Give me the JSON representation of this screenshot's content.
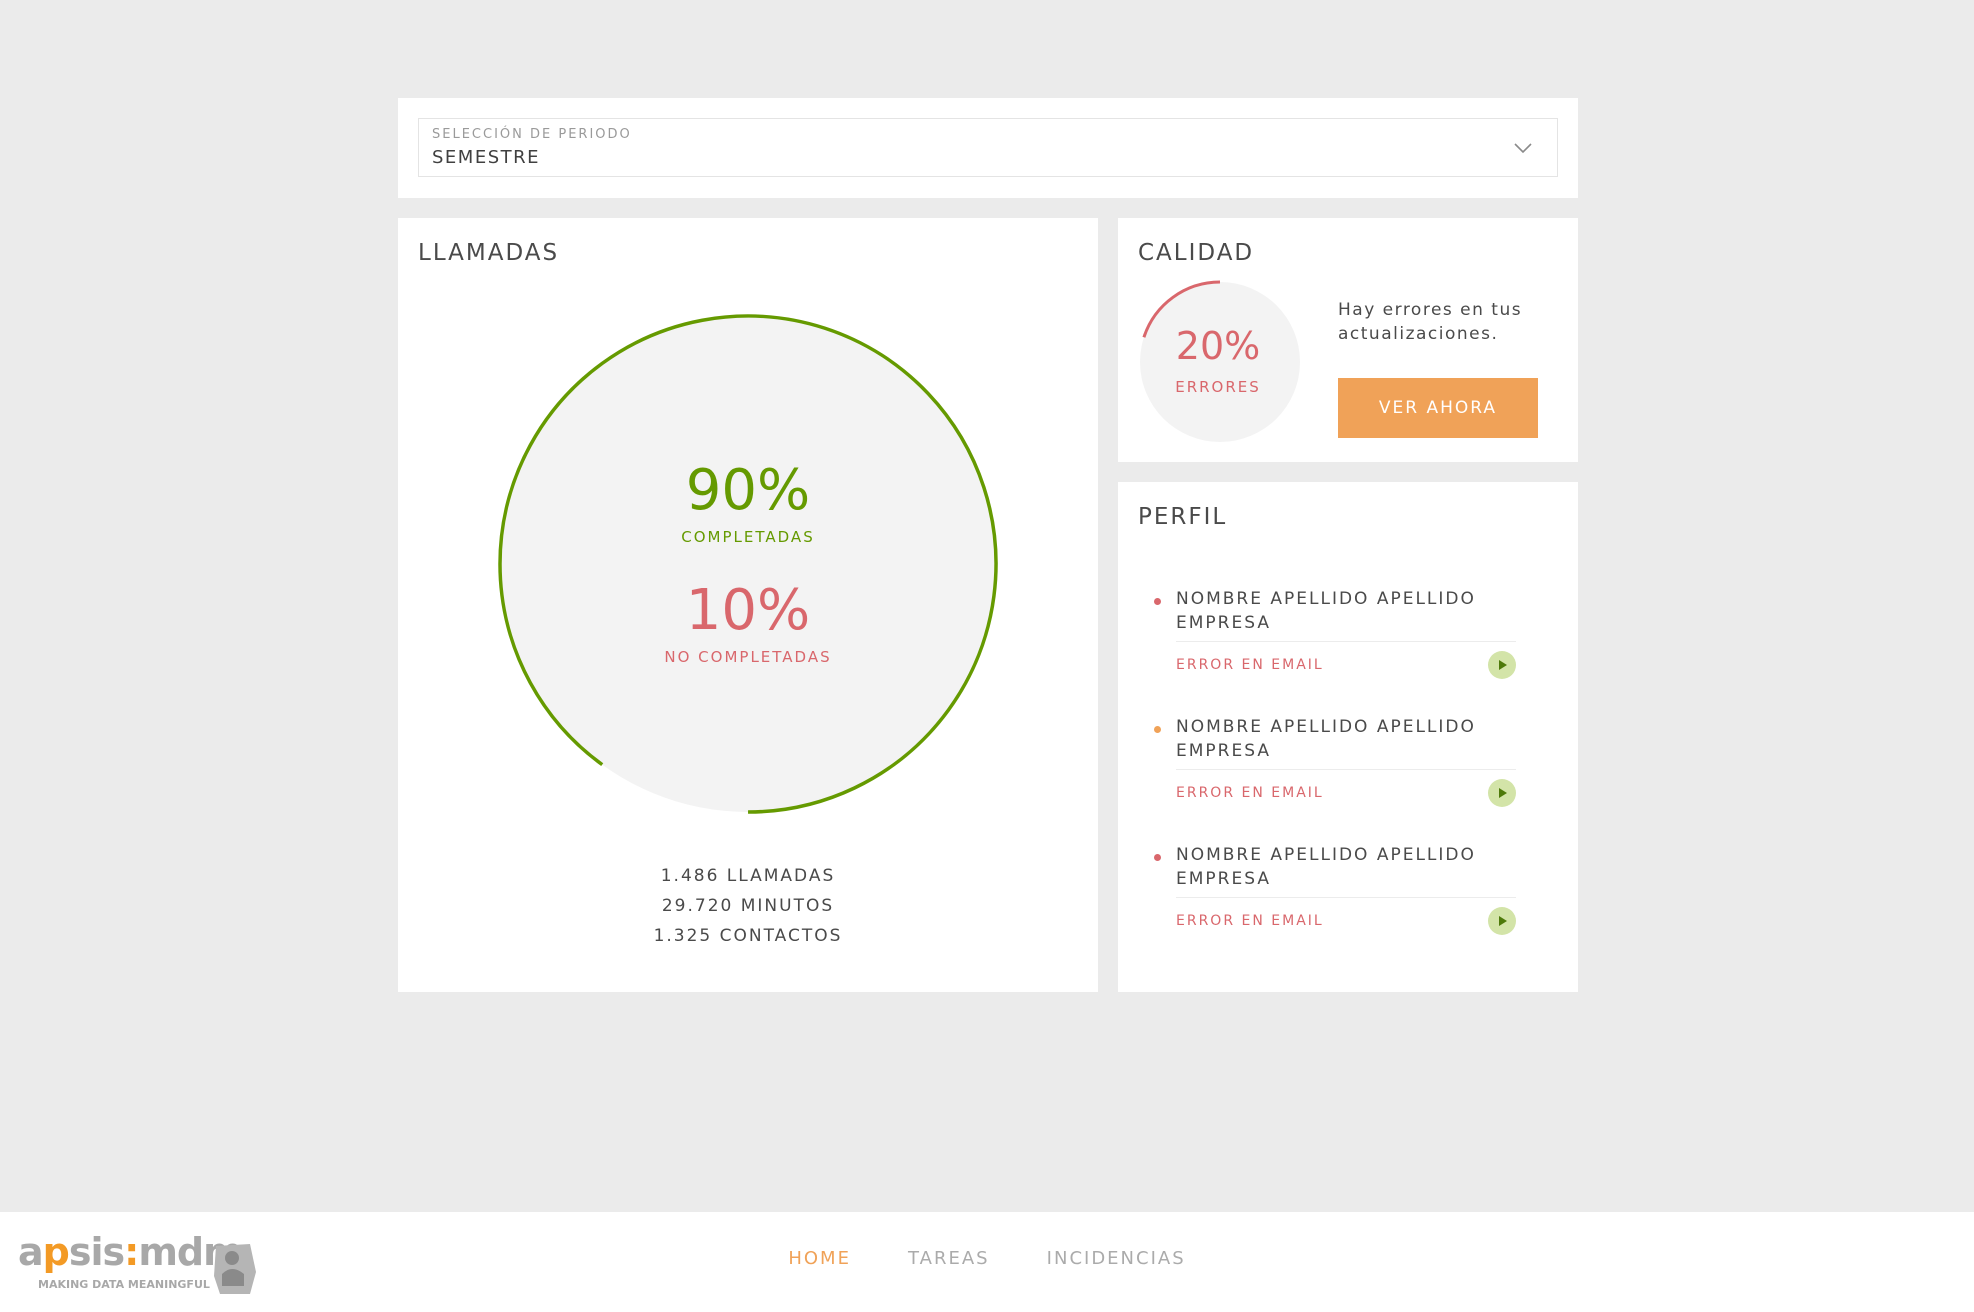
{
  "period": {
    "label": "SELECCIÓN DE PERIODO",
    "value": "SEMESTRE",
    "icon": "chevron-down-icon"
  },
  "llamadas": {
    "title": "LLAMADAS",
    "completed_fraction": 0.9,
    "completed_pct": "90%",
    "completed_label": "COMPLETADAS",
    "not_completed_pct": "10%",
    "not_completed_label": "NO COMPLETADAS",
    "stats": {
      "calls": "1.486 LLAMADAS",
      "minutes": "29.720 MINUTOS",
      "contacts": "1.325 CONTACTOS"
    }
  },
  "calidad": {
    "title": "CALIDAD",
    "error_fraction": 0.2,
    "pct": "20%",
    "pct_label": "ERRORES",
    "message": "Hay errores en tus actualizaciones.",
    "button": "VER AHORA"
  },
  "perfil": {
    "title": "PERFIL",
    "items": [
      {
        "name": "NOMBRE APELLIDO APELLIDO EMPRESA",
        "error": "ERROR EN EMAIL",
        "dot_color": "#d9676c",
        "icon": "play-icon"
      },
      {
        "name": "NOMBRE APELLIDO APELLIDO EMPRESA",
        "error": "ERROR EN EMAIL",
        "dot_color": "#f0a258",
        "icon": "play-icon"
      },
      {
        "name": "NOMBRE APELLIDO APELLIDO EMPRESA",
        "error": "ERROR EN EMAIL",
        "dot_color": "#d9676c",
        "icon": "play-icon"
      }
    ]
  },
  "footer": {
    "logo": "apsismdm",
    "logo_tagline": "MAKING DATA MEANINGFUL",
    "nav": [
      "HOME",
      "TAREAS",
      "INCIDENCIAS"
    ],
    "active": "HOME"
  },
  "colors": {
    "green": "#659a00",
    "red": "#d9676c",
    "orange": "#f0a258",
    "background": "#ebebeb"
  }
}
